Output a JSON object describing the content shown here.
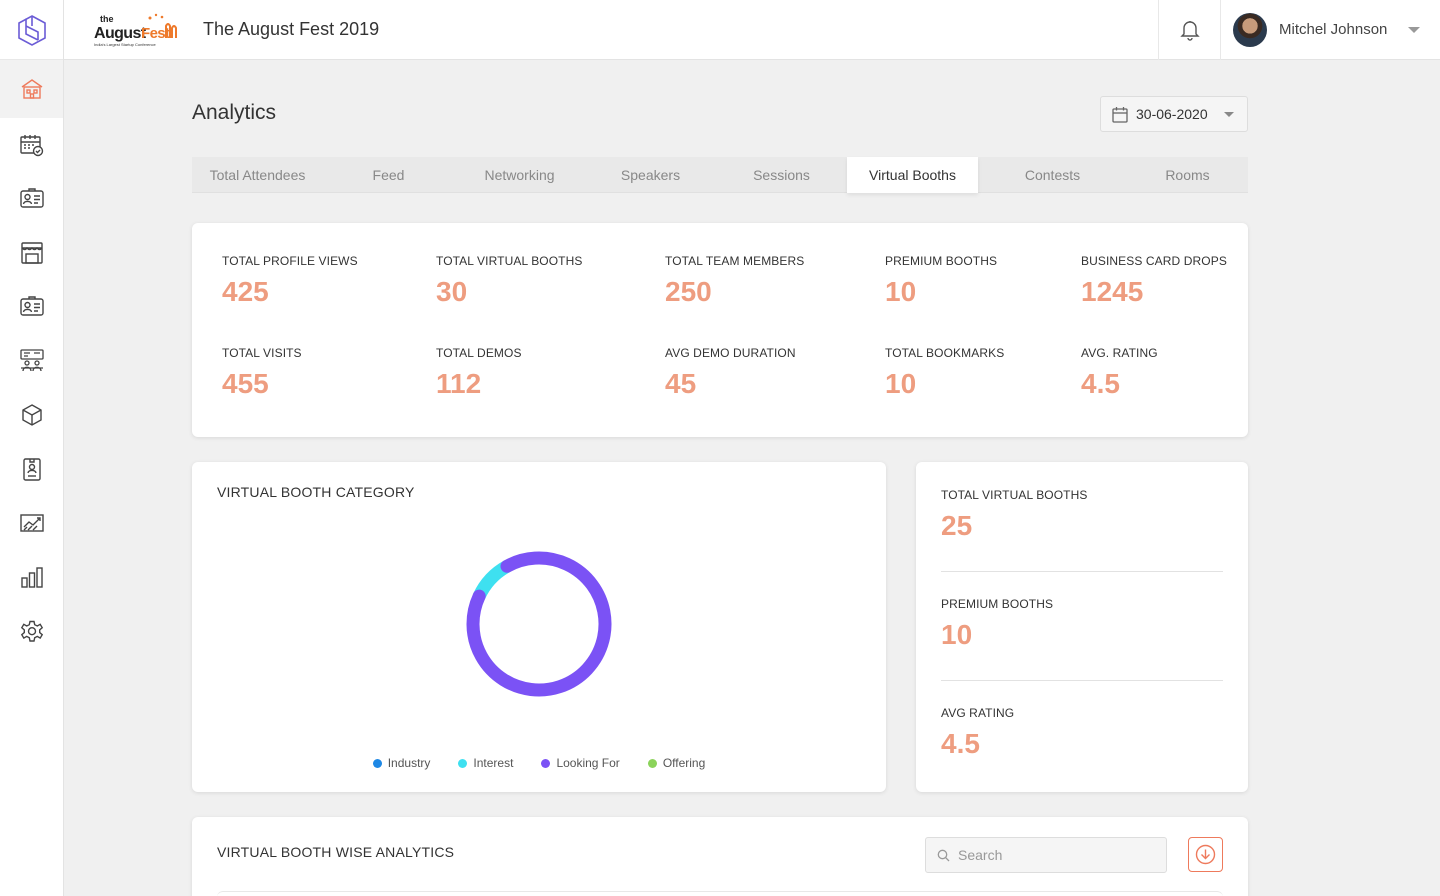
{
  "header": {
    "event_title": "The August Fest 2019",
    "logo_text_top": "the",
    "logo_text_main": "August",
    "logo_text_accent": "Fest",
    "logo_tagline": "India's Largest Startup Conference",
    "user_name": "Mitchel Johnson"
  },
  "sidebar": {
    "items": [
      {
        "icon": "home-icon"
      },
      {
        "icon": "calendar-check-icon"
      },
      {
        "icon": "id-card-icon"
      },
      {
        "icon": "booth-icon"
      },
      {
        "icon": "attendee-card-icon"
      },
      {
        "icon": "meeting-icon"
      },
      {
        "icon": "cube-icon"
      },
      {
        "icon": "badge-icon"
      },
      {
        "icon": "chart-line-icon"
      },
      {
        "icon": "bar-chart-icon"
      },
      {
        "icon": "settings-icon"
      }
    ]
  },
  "page": {
    "title": "Analytics",
    "date": "30-06-2020"
  },
  "tabs": [
    {
      "label": "Total Attendees"
    },
    {
      "label": "Feed"
    },
    {
      "label": "Networking"
    },
    {
      "label": "Speakers"
    },
    {
      "label": "Sessions"
    },
    {
      "label": "Virtual Booths",
      "active": true
    },
    {
      "label": "Contests"
    },
    {
      "label": "Rooms"
    }
  ],
  "stats": [
    {
      "label": "TOTAL PROFILE VIEWS",
      "value": "425"
    },
    {
      "label": "TOTAL VIRTUAL BOOTHS",
      "value": "30"
    },
    {
      "label": "TOTAL TEAM MEMBERS",
      "value": "250"
    },
    {
      "label": "PREMIUM BOOTHS",
      "value": "10"
    },
    {
      "label": "BUSINESS CARD DROPS",
      "value": "1245"
    },
    {
      "label": "TOTAL VISITS",
      "value": "455"
    },
    {
      "label": "TOTAL DEMOS",
      "value": "112"
    },
    {
      "label": "AVG DEMO DURATION",
      "value": "45"
    },
    {
      "label": "TOTAL BOOKMARKS",
      "value": "10"
    },
    {
      "label": "AVG. RATING",
      "value": "4.5"
    }
  ],
  "category_card": {
    "title": "VIRTUAL BOOTH CATEGORY"
  },
  "chart_data": {
    "type": "pie",
    "variant": "donut",
    "categories": [
      "Industry",
      "Interest",
      "Looking For",
      "Offering"
    ],
    "values": [
      0,
      10,
      90,
      0
    ],
    "colors": [
      "#1e88e5",
      "#3ee0f0",
      "#7b52f5",
      "#8bd35a"
    ],
    "legend": "bottom"
  },
  "side_stats": [
    {
      "label": "TOTAL VIRTUAL BOOTHS",
      "value": "25"
    },
    {
      "label": "PREMIUM BOOTHS",
      "value": "10"
    },
    {
      "label": "AVG RATING",
      "value": "4.5"
    }
  ],
  "table_card": {
    "title": "VIRTUAL BOOTH WISE ANALYTICS",
    "search_placeholder": "Search"
  },
  "colors": {
    "accent": "#ee9d80",
    "sidebar_active_icon": "#ee7a5c"
  }
}
